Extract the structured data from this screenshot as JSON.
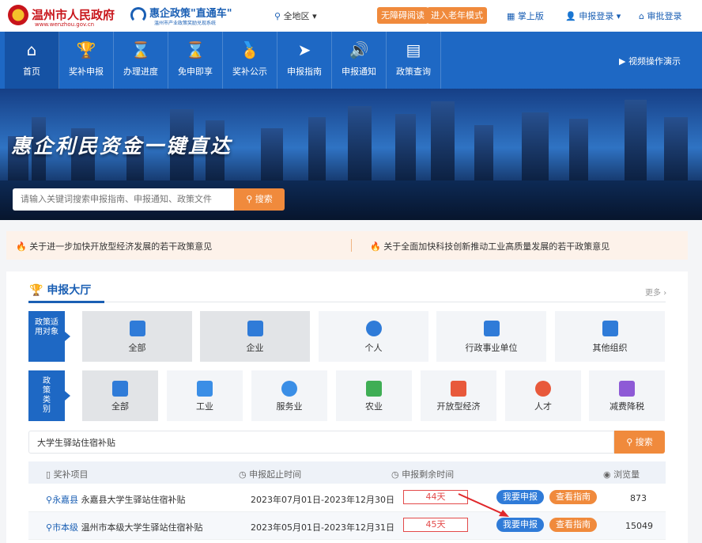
{
  "header": {
    "site_title": "温州市人民政府",
    "site_url": "www.wenzhou.gov.cn",
    "brand_name": "惠企政策\"直通车\"",
    "brand_sub": "温州市产业政策奖励兑现系统",
    "region": "全地区",
    "accessible_label": "无障碍阅读",
    "elder_label": "进入老年模式",
    "mobile_label": "掌上版",
    "login_label": "申报登录",
    "review_label": "审批登录"
  },
  "nav": {
    "items": [
      {
        "label": "首页",
        "icon": "home-icon"
      },
      {
        "label": "奖补申报",
        "icon": "trophy-icon"
      },
      {
        "label": "办理进度",
        "icon": "hourglass-icon"
      },
      {
        "label": "免申即享",
        "icon": "hourglass-icon"
      },
      {
        "label": "奖补公示",
        "icon": "medal-icon"
      },
      {
        "label": "申报指南",
        "icon": "compass-icon"
      },
      {
        "label": "申报通知",
        "icon": "speaker-icon"
      },
      {
        "label": "政策查询",
        "icon": "document-icon"
      }
    ],
    "video_label": "视频操作演示"
  },
  "banner": {
    "slogan": "惠企利民资金一键直达",
    "search_placeholder": "请输入关键词搜索申报指南、申报通知、政策文件",
    "search_button": "搜索"
  },
  "notices": [
    "关于进一步加快开放型经济发展的若干政策意见",
    "关于全面加快科技创新推动工业高质量发展的若干政策意见"
  ],
  "hall": {
    "title": "申报大厅",
    "more": "更多",
    "scope_label": "政策适用对象",
    "scope_tiles": [
      {
        "label": "全部",
        "icon": "layers-icon",
        "color": "#2f7bd8"
      },
      {
        "label": "企业",
        "icon": "building-icon",
        "color": "#2f7bd8"
      },
      {
        "label": "个人",
        "icon": "person-icon",
        "color": "#2f7bd8"
      },
      {
        "label": "行政事业单位",
        "icon": "institution-icon",
        "color": "#2f7bd8"
      },
      {
        "label": "其他组织",
        "icon": "grid-icon",
        "color": "#2f7bd8"
      }
    ],
    "type_label": "政策类别",
    "type_tiles": [
      {
        "label": "全部",
        "icon": "grid-icon",
        "color": "#2f7bd8"
      },
      {
        "label": "工业",
        "icon": "robot-arm-icon",
        "color": "#3a8ee6"
      },
      {
        "label": "服务业",
        "icon": "cloud-icon",
        "color": "#3a8ee6"
      },
      {
        "label": "农业",
        "icon": "leaf-icon",
        "color": "#3fae55"
      },
      {
        "label": "开放型经济",
        "icon": "plane-icon",
        "color": "#e8593b"
      },
      {
        "label": "人才",
        "icon": "person-badge-icon",
        "color": "#e8593b"
      },
      {
        "label": "减费降税",
        "icon": "chart-icon",
        "color": "#8e5ad6"
      }
    ],
    "keyword": "大学生驿站住宿补贴",
    "search_button": "搜索",
    "columns": [
      "奖补项目",
      "申报起止时间",
      "申报剩余时间",
      "浏览量"
    ],
    "rows": [
      {
        "region": "永嘉县",
        "project": "永嘉县大学生驿站住宿补贴",
        "period": "2023年07月01日-2023年12月30日",
        "remaining": "44天",
        "apply": "我要申报",
        "guide": "查看指南",
        "views": "873"
      },
      {
        "region": "市本级",
        "project": "温州市本级大学生驿站住宿补贴",
        "period": "2023年05月01日-2023年12月31日",
        "remaining": "45天",
        "apply": "我要申报",
        "guide": "查看指南",
        "views": "15049"
      }
    ]
  }
}
